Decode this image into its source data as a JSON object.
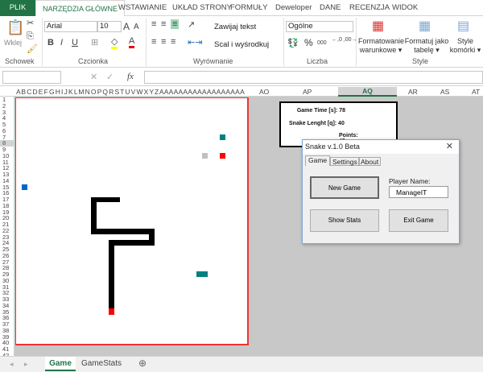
{
  "ribbon_tabs": [
    "PLIK",
    "NARZĘDZIA GŁÓWNE",
    "WSTAWIANIE",
    "UKŁAD STRONY",
    "FORMUŁY",
    "Deweloper",
    "DANE",
    "RECENZJA",
    "WIDOK"
  ],
  "ribbon": {
    "paste": "Wklej",
    "clipboard_group": "Schowek",
    "font_name": "Arial",
    "font_size": "10",
    "font_group": "Czcionka",
    "wrap_text": "Zawijaj tekst",
    "merge_center": "Scal i wyśrodkuj",
    "alignment_group": "Wyrównanie",
    "number_format": "Ogólne",
    "number_group": "Liczba",
    "percent": "%",
    "thousands": "000",
    "cond_format_1": "Formatowanie",
    "cond_format_2": "warunkowe",
    "format_table_1": "Formatuj jako",
    "format_table_2": "tabelę",
    "cell_styles_1": "Style",
    "cell_styles_2": "komórki",
    "styles_group": "Style"
  },
  "formula_bar": {
    "name_box": "",
    "fx": "fx",
    "formula": ""
  },
  "columns_narrow": "A B C D E F G H I  J K L M N O P Q R S T U V W X Y Z A A A A A A A A A A A A A A A A A A",
  "columns": [
    "AO",
    "AP",
    "AQ",
    "AR",
    "AS",
    "AT"
  ],
  "selected_column": "AQ",
  "selected_row": 8,
  "rows": 42,
  "stats": {
    "game_time": "Game Time [s]: 78",
    "snake_length": "Snake Lenght [q]: 40",
    "points": "Points: 42"
  },
  "dialog": {
    "title": "Snake v.1.0 Beta",
    "close": "✕",
    "tabs": [
      "Game",
      "Settings",
      "About"
    ],
    "new_game": "New Game",
    "show_stats": "Show Stats",
    "exit_game": "Exit Game",
    "player_label": "Player Name:",
    "player_name": "ManageIT"
  },
  "sheets": [
    "Game",
    "GameStats"
  ],
  "active_sheet": "Game",
  "colors": {
    "excel_green": "#217346",
    "board_border": "#ee3333",
    "snake": "#000000",
    "snake_head": "#ff0000",
    "food_red": "#ff0000",
    "teal": "#008080",
    "blue": "#0066cc",
    "grey": "#c0c0c0"
  }
}
